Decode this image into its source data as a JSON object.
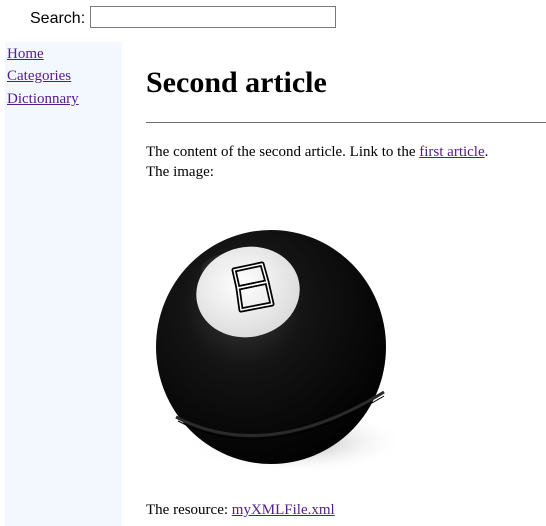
{
  "search": {
    "label": "Search:",
    "value": "",
    "placeholder": ""
  },
  "sidebar": {
    "items": [
      {
        "label": "Home"
      },
      {
        "label": "Categories"
      },
      {
        "label": "Dictionnary"
      }
    ]
  },
  "article": {
    "title": "Second article",
    "content_prefix": "The content of the second article. Link to the ",
    "first_article_link": "first article",
    "content_suffix": ".",
    "image_label": "The image:",
    "image_icon": "magic-8-ball",
    "resource_prefix": "The resource: ",
    "resource_link": "myXMLFile.xml"
  },
  "colors": {
    "link_visited": "#551a8b",
    "sidebar_background": "#f3f8ff",
    "ball": "#0b0b0b"
  }
}
